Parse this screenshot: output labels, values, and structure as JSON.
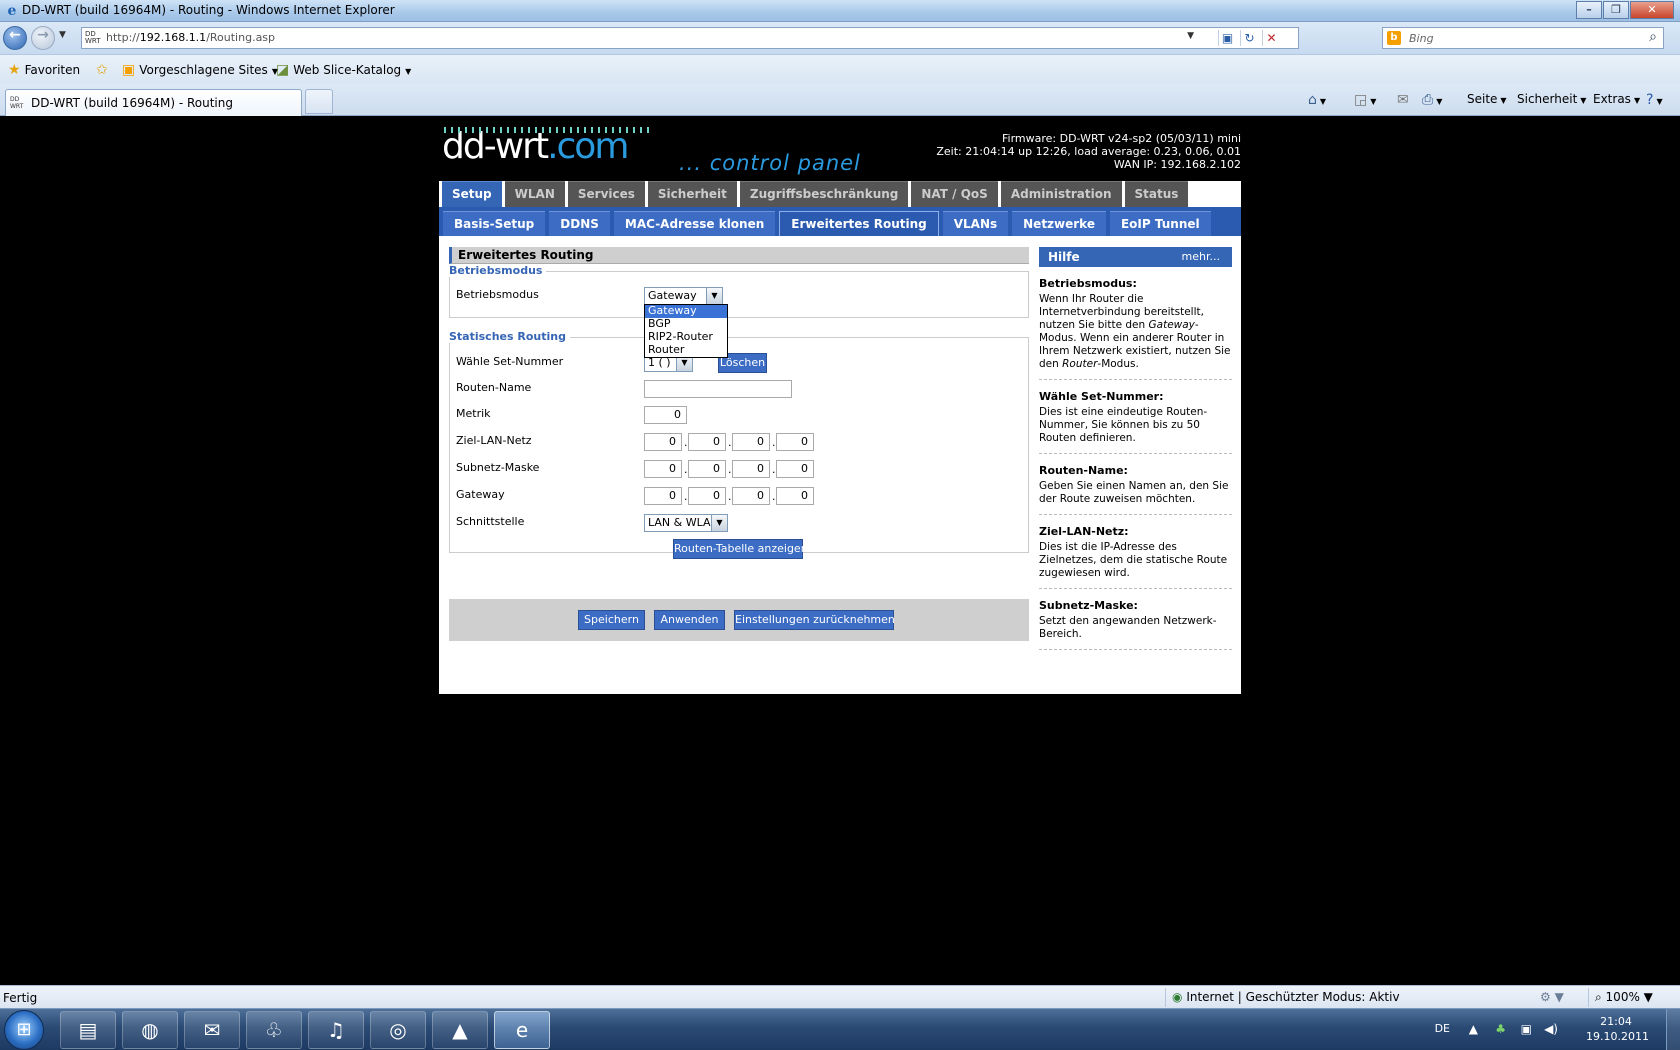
{
  "browser": {
    "window_title": "DD-WRT (build 16964M) - Routing - Windows Internet Explorer",
    "url_prefix": "http://",
    "url_host": "192.168.1.1",
    "url_path": "/Routing.asp",
    "search_placeholder": "Bing",
    "favorites": {
      "favorites_label": "Favoriten",
      "suggested_sites_label": "Vorgeschlagene Sites",
      "web_slice_label": "Web Slice-Katalog"
    },
    "tab_title": "DD-WRT (build 16964M) - Routing",
    "commands": {
      "page": "Seite",
      "security": "Sicherheit",
      "extras": "Extras"
    },
    "status": {
      "text": "Fertig",
      "zone": "Internet | Geschützter Modus: Aktiv",
      "zoom": "100%"
    }
  },
  "ddwrt": {
    "logo_main": "dd-wrt",
    "logo_com": ".com",
    "control_panel": "... control panel",
    "firmware": "Firmware: DD-WRT v24-sp2 (05/03/11) mini",
    "time": "Zeit: 21:04:14 up 12:26, load average: 0.23, 0.06, 0.01",
    "wan_ip": "WAN IP: 192.168.2.102",
    "main_tabs": [
      "Setup",
      "WLAN",
      "Services",
      "Sicherheit",
      "Zugriffsbeschränkung",
      "NAT / QoS",
      "Administration",
      "Status"
    ],
    "sub_tabs": [
      "Basis-Setup",
      "DDNS",
      "MAC-Adresse klonen",
      "Erweitertes Routing",
      "VLANs",
      "Netzwerke",
      "EoIP Tunnel"
    ],
    "section_title": "Erweitertes Routing",
    "operating_mode": {
      "legend": "Betriebsmodus",
      "label": "Betriebsmodus",
      "value": "Gateway",
      "options": [
        "Gateway",
        "BGP",
        "RIP2-Router",
        "Router"
      ]
    },
    "static_routing": {
      "legend": "Statisches Routing",
      "set_number_label": "Wähle Set-Nummer",
      "set_number_value": "1 ( )",
      "delete_button": "Löschen",
      "route_name_label": "Routen-Name",
      "route_name_value": "",
      "metric_label": "Metrik",
      "metric_value": "0",
      "dest_lan_label": "Ziel-LAN-Netz",
      "dest_lan": [
        "0",
        "0",
        "0",
        "0"
      ],
      "subnet_label": "Subnetz-Maske",
      "subnet": [
        "0",
        "0",
        "0",
        "0"
      ],
      "gateway_label": "Gateway",
      "gateway": [
        "0",
        "0",
        "0",
        "0"
      ],
      "interface_label": "Schnittstelle",
      "interface_value": "LAN & WLAN",
      "show_table_button": "Routen-Tabelle anzeigen"
    },
    "buttons": {
      "save": "Speichern",
      "apply": "Anwenden",
      "reset": "Einstellungen zurücknehmen"
    },
    "help": {
      "title": "Hilfe",
      "more": "mehr...",
      "blocks": [
        {
          "title": "Betriebsmodus:",
          "text_before": "Wenn Ihr Router die Internetverbindung bereitstellt, nutzen Sie bitte den ",
          "em1": "Gateway",
          "text_mid": "-Modus. Wenn ein anderer Router in Ihrem Netzwerk existiert, nutzen Sie den ",
          "em2": "Router",
          "text_after": "-Modus."
        },
        {
          "title": "Wähle Set-Nummer:",
          "text": "Dies ist eine eindeutige Routen-Nummer, Sie können bis zu 50 Routen definieren."
        },
        {
          "title": "Routen-Name:",
          "text": "Geben Sie einen Namen an, den Sie der Route zuweisen möchten."
        },
        {
          "title": "Ziel-LAN-Netz:",
          "text": "Dies ist die IP-Adresse des Zielnetzes, dem die statische Route zugewiesen wird."
        },
        {
          "title": "Subnetz-Maske:",
          "text": "Setzt den angewanden Netzwerk-Bereich."
        }
      ]
    }
  },
  "taskbar": {
    "language": "DE",
    "time": "21:04",
    "date": "19.10.2011"
  }
}
